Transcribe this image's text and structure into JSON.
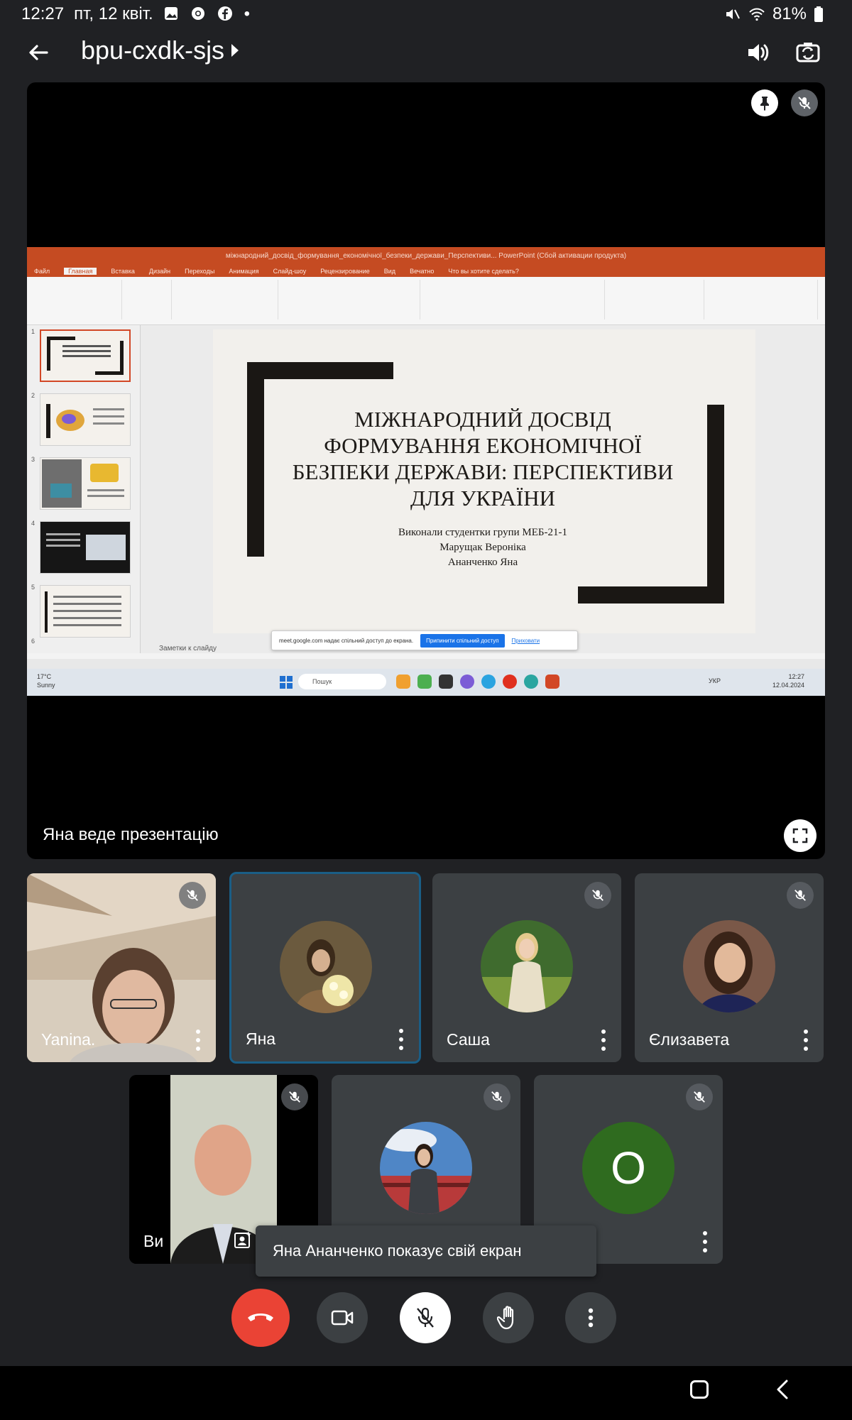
{
  "status_bar": {
    "time": "12:27",
    "date": "пт, 12 квіт.",
    "battery": "81%"
  },
  "top_bar": {
    "meeting_code": "bpu-cxdk-sjs"
  },
  "stage": {
    "presenter_label": "Яна веде презентацію"
  },
  "screen_share": {
    "window_title": "міжнародний_досвід_формування_економічної_безпеки_держави_Перспективи... PowerPoint (Сбой активации продукта)",
    "ribbon_tabs": [
      "Файл",
      "Главная",
      "Вставка",
      "Дизайн",
      "Переходы",
      "Анимация",
      "Слайд-шоу",
      "Рецензирование",
      "Вид",
      "Вечатно",
      "Что вы хотите сделать?"
    ],
    "slide_title": "МІЖНАРОДНИЙ ДОСВІД ФОРМУВАННЯ ЕКОНОМІЧНОЇ БЕЗПЕКИ ДЕРЖАВИ: ПЕРСПЕКТИВИ ДЛЯ УКРАЇНИ",
    "slide_subtitle_lines": [
      "Виконали студентки групи МЕБ-21-1",
      "Марущак Вероніка",
      "Ананченко Яна"
    ],
    "notes_placeholder": "Заметки к слайду",
    "share_banner_text": "meet.google.com надає спільний доступ до екрана.",
    "share_banner_accept": "Припинити спільний доступ",
    "share_banner_hide": "Приховати",
    "thumb_numbers": [
      "1",
      "2",
      "3",
      "4",
      "5",
      "6"
    ],
    "weather_temp": "17°C",
    "weather_desc": "Sunny",
    "taskbar_search": "Пошук",
    "taskbar_lang": "УКР",
    "taskbar_time": "12:27",
    "taskbar_date": "12.04.2024"
  },
  "participants": [
    {
      "name": "Yanina.",
      "type": "video"
    },
    {
      "name": "Яна",
      "type": "photo",
      "active": true
    },
    {
      "name": "Саша",
      "type": "photo"
    },
    {
      "name": "Єлизавета",
      "type": "photo"
    },
    {
      "name": "Ви",
      "type": "video"
    },
    {
      "name": "",
      "type": "photo"
    },
    {
      "name": "",
      "type": "letter",
      "letter": "O",
      "color": "#2f6b1f"
    }
  ],
  "toast": {
    "text": "Яна Ананченко показує свій екран"
  },
  "colors": {
    "background": "#202124",
    "tile": "#3c4043",
    "end_call": "#ea4335",
    "active_border": "#1a5e86",
    "powerpoint": "#c54b22"
  }
}
